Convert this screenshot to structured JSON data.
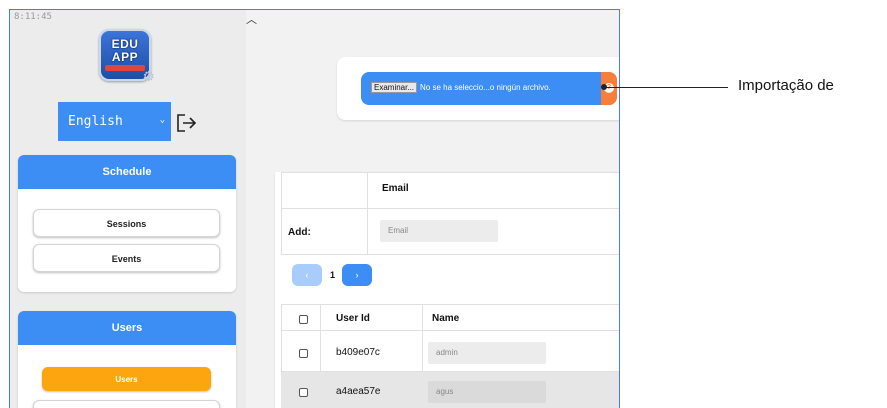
{
  "sidebar": {
    "clock": "8:11:45",
    "logo": {
      "line1": "EDU",
      "line2": "APP"
    },
    "language": {
      "selected": "English"
    },
    "schedule_panel": {
      "title": "Schedule",
      "items": [
        {
          "label": "Sessions"
        },
        {
          "label": "Events"
        }
      ]
    },
    "users_panel": {
      "title": "Users",
      "items": [
        {
          "label": "Users",
          "active": true
        }
      ]
    }
  },
  "upload": {
    "browse_label": "Examinar...",
    "file_status": "No se ha seleccio...o ningún archivo.",
    "help_glyph": "?"
  },
  "callout": {
    "label": "Importação de"
  },
  "email_table": {
    "header": "Email",
    "add_label": "Add:",
    "email_placeholder": "Email"
  },
  "pagination": {
    "prev": "‹",
    "page": "1",
    "next": "›"
  },
  "users_table": {
    "columns": [
      "User Id",
      "Name"
    ],
    "rows": [
      {
        "user_id": "b409e07c",
        "name": "admin"
      },
      {
        "user_id": "a4aea57e",
        "name": "agus"
      }
    ]
  },
  "colors": {
    "primary": "#3c8df4",
    "active": "#fda50f",
    "help": "#f77f3b"
  }
}
